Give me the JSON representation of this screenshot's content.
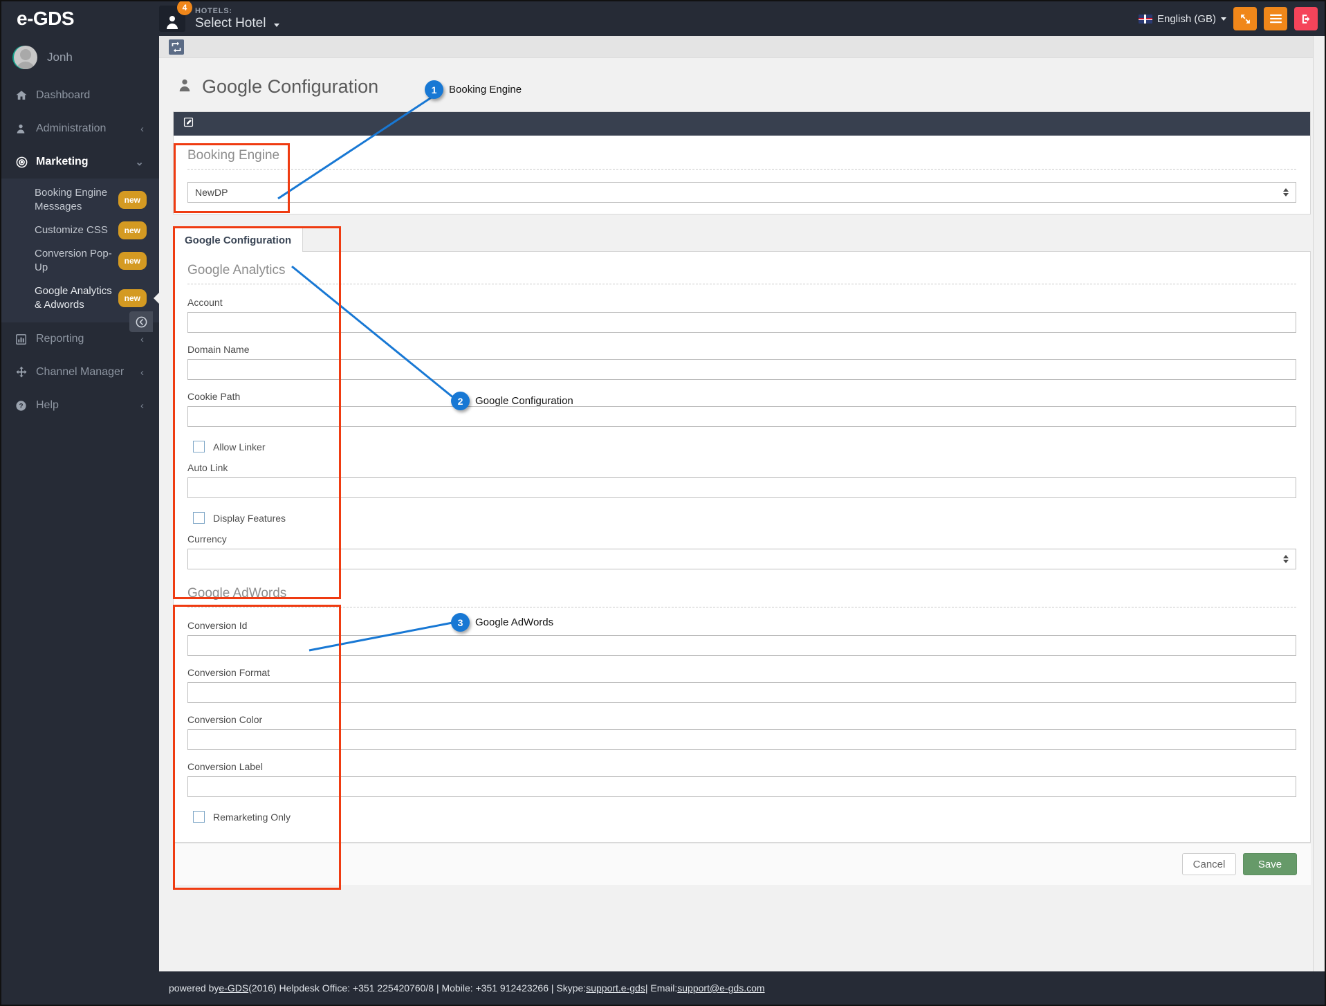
{
  "topbar": {
    "brand": "e-GDS",
    "badge_count": "4",
    "hotels_label": "HOTELS:",
    "hotels_value": "Select Hotel",
    "language": "English (GB)",
    "icons": {
      "user": "user-badge-icon",
      "flag": "uk-flag-icon",
      "fullscreen": "fullscreen-icon",
      "menu": "hamburger-menu-icon",
      "logout": "logout-icon"
    },
    "accent_orange": "#f0871a",
    "accent_red": "#f5445a"
  },
  "sidebar": {
    "profile_name": "Jonh",
    "items": [
      {
        "label": "Dashboard",
        "icon": "home-icon",
        "chevron": "",
        "active": false
      },
      {
        "label": "Administration",
        "icon": "user-icon",
        "chevron": "‹",
        "active": false
      },
      {
        "label": "Marketing",
        "icon": "target-icon",
        "chevron": "⌄",
        "active": true
      },
      {
        "label": "Reporting",
        "icon": "bar-chart-icon",
        "chevron": "‹",
        "active": false
      },
      {
        "label": "Channel Manager",
        "icon": "arrows-move-icon",
        "chevron": "‹",
        "active": false
      },
      {
        "label": "Help",
        "icon": "question-circle-icon",
        "chevron": "‹",
        "active": false
      }
    ],
    "submenu": [
      {
        "label": "Booking Engine Messages",
        "badge": "new",
        "current": false
      },
      {
        "label": "Customize CSS",
        "badge": "new",
        "current": false
      },
      {
        "label": "Conversion Pop-Up",
        "badge": "new",
        "current": false
      },
      {
        "label": "Google Analytics & Adwords",
        "badge": "new",
        "current": true
      }
    ],
    "collapse_icon": "collapse-left-icon",
    "badge_color": "#d49a22"
  },
  "toolbar": {
    "refresh_icon": "refresh-icon"
  },
  "page": {
    "title": "Google Configuration",
    "title_icon": "user-icon"
  },
  "booking_panel": {
    "head_icon": "edit-icon",
    "section_title": "Booking Engine",
    "select_value": "NewDP"
  },
  "tabs": [
    {
      "label": "Google Configuration",
      "active": true
    }
  ],
  "google_analytics": {
    "section_title": "Google Analytics",
    "fields": [
      {
        "label": "Account",
        "value": "",
        "type": "text"
      },
      {
        "label": "Domain Name",
        "value": "",
        "type": "text"
      },
      {
        "label": "Cookie Path",
        "value": "",
        "type": "text"
      }
    ],
    "allow_linker": {
      "label": "Allow Linker",
      "checked": false
    },
    "auto_link": {
      "label": "Auto Link",
      "value": ""
    },
    "display_features": {
      "label": "Display Features",
      "checked": false
    },
    "currency": {
      "label": "Currency",
      "value": ""
    }
  },
  "google_adwords": {
    "section_title": "Google AdWords",
    "fields": [
      {
        "label": "Conversion Id",
        "value": ""
      },
      {
        "label": "Conversion Format",
        "value": ""
      },
      {
        "label": "Conversion Color",
        "value": ""
      },
      {
        "label": "Conversion Label",
        "value": ""
      }
    ],
    "remarketing_only": {
      "label": "Remarketing Only",
      "checked": false
    }
  },
  "form_actions": {
    "cancel_label": "Cancel",
    "save_label": "Save",
    "save_color": "#669a69"
  },
  "footer": {
    "prefix": "powered by ",
    "brand": "e-GDS",
    "year_office": " (2016) Helpdesk Office: +351 225420760/8  |  Mobile: +351 912423266  |  Skype: ",
    "skype": "support.e-gds",
    "email_label": "  |  Email: ",
    "email": "support@e-gds.com"
  },
  "annotations": {
    "color": "#ef3b11",
    "marker_color": "#1878d4",
    "markers": [
      {
        "number": "1",
        "label": "Booking Engine"
      },
      {
        "number": "2",
        "label": "Google Configuration"
      },
      {
        "number": "3",
        "label": "Google AdWords"
      }
    ]
  }
}
